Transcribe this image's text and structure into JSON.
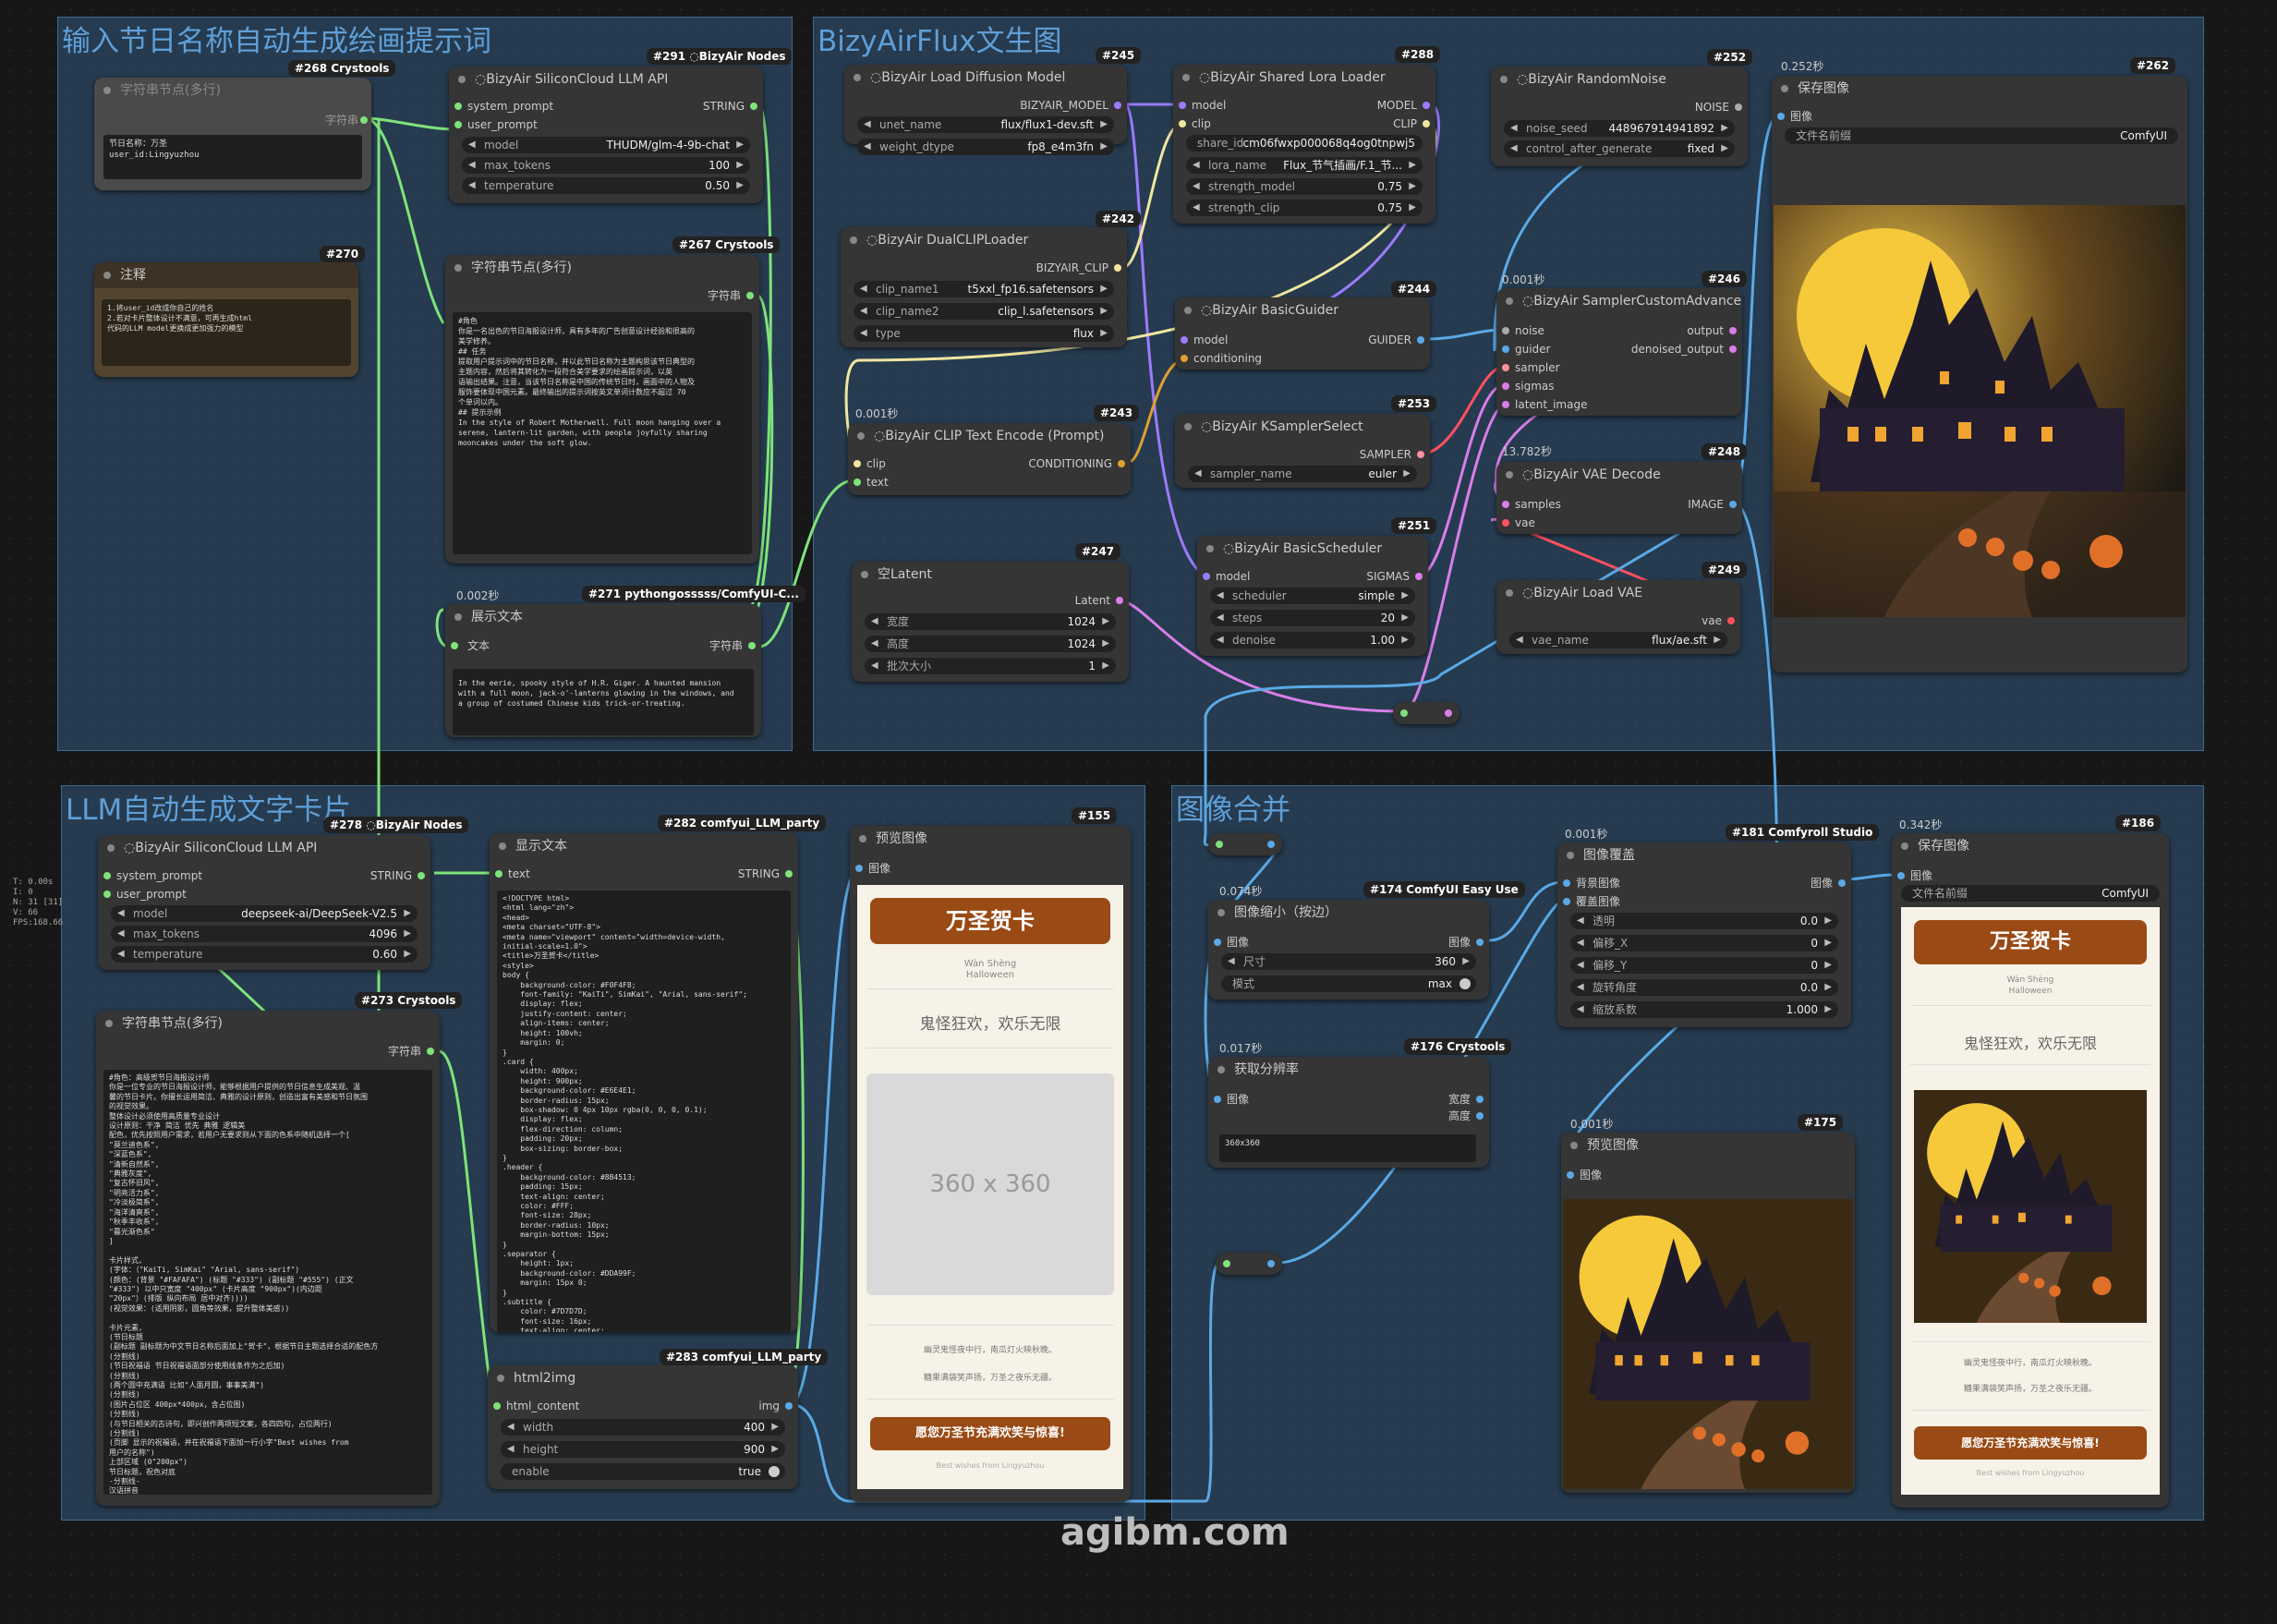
{
  "colors": {
    "group_bg": "#3a6894",
    "group_title": "#5f9fd8",
    "link_green": "#7ee37a",
    "link_blue": "#5aa9e6",
    "link_purple": "#9b7bff",
    "link_pink": "#d97ee9",
    "link_yellow": "#f0e6a0",
    "link_red": "#ff5060",
    "card_orange": "#9a4a14"
  },
  "groups": {
    "g1": "输入节日名称自动生成绘画提示词",
    "g2": "BizyAirFlux文生图",
    "g3": "LLM自动生成文字卡片",
    "g4": "图像合并"
  },
  "watermark": "agibm.com",
  "fps": "T: 0.00s\nI: 0\nN: 31 [31]\nV: 66\nFPS:168.66",
  "n268": {
    "badge": "#268 Crystools",
    "title": "字符串节点(多行)",
    "out": "字符串",
    "text": "节日名称：万圣\nuser_id:Lingyuzhou"
  },
  "n270": {
    "badge": "#270",
    "title": "注释",
    "text": "1.将user_id改成你自己的姓名\n2.若对卡片整体设计不满意，可再生成html\n代码的LLM model更换成更加强力的模型"
  },
  "n291": {
    "badge": "#291 ◌BizyAir Nodes",
    "title": "◌BizyAir SiliconCloud LLM API",
    "in1": "system_prompt",
    "in2": "user_prompt",
    "out": "STRING",
    "w": [
      {
        "l": "model",
        "v": "THUDM/glm-4-9b-chat"
      },
      {
        "l": "max_tokens",
        "v": "100"
      },
      {
        "l": "temperature",
        "v": "0.50"
      }
    ]
  },
  "n267": {
    "badge": "#267 Crystools",
    "title": "字符串节点(多行)",
    "out": "字符串",
    "text": "#角色\n你是一名出色的节日海报设计师，具有多年的广告创意设计经验和很高的\n美学修养。\n## 任务\n提取用户提示词中的节日名称，并以此节日名称为主题构思该节日典型的\n主题内容，然后将其转化为一段符合美学要求的绘画提示词，以英\n语输出结果。注意，当该节日名称是中国的传统节日时，画面中的人物及\n服饰要体现中国元素。最终输出的提示词按英文单词计数应不超过 70\n个单词以内。\n## 提示示例\nIn the style of Robert Motherwell. Full moon hanging over a\nserene, lantern-lit garden, with people joyfully sharing\nmooncakes under the soft glow."
  },
  "n271": {
    "badge": "#271 pythongosssss/ComfyUI-C...",
    "timing": "0.002秒",
    "title": "展示文本",
    "in": "文本",
    "out": "字符串",
    "text": "In the eerie, spooky style of H.R. Giger. A haunted mansion\nwith a full moon, jack-o'-lanterns glowing in the windows, and\na group of costumed Chinese kids trick-or-treating."
  },
  "n245": {
    "badge": "#245",
    "title": "◌BizyAir Load Diffusion Model",
    "out": "BIZYAIR_MODEL",
    "w": [
      {
        "l": "unet_name",
        "v": "flux/flux1-dev.sft"
      },
      {
        "l": "weight_dtype",
        "v": "fp8_e4m3fn"
      }
    ]
  },
  "n288": {
    "badge": "#288",
    "title": "◌BizyAir Shared Lora Loader",
    "in1": "model",
    "in2": "clip",
    "out1": "MODEL",
    "out2": "CLIP",
    "share_id": "cm06fwxp000068q4og0tnpwj5",
    "share_label": "share_id",
    "w": [
      {
        "l": "lora_name",
        "v": "Flux_节气插画/F.1_节..."
      },
      {
        "l": "strength_model",
        "v": "0.75"
      },
      {
        "l": "strength_clip",
        "v": "0.75"
      }
    ]
  },
  "n252": {
    "badge": "#252",
    "title": "◌BizyAir RandomNoise",
    "out": "NOISE",
    "w": [
      {
        "l": "noise_seed",
        "v": "448967914941892"
      },
      {
        "l": "control_after_generate",
        "v": "fixed"
      }
    ]
  },
  "n262": {
    "badge": "#262",
    "timing": "0.252秒",
    "title": "保存图像",
    "in": "图像",
    "w": {
      "l": "文件名前缀",
      "v": "ComfyUI"
    }
  },
  "n242": {
    "badge": "#242",
    "title": "◌BizyAir DualCLIPLoader",
    "out": "BIZYAIR_CLIP",
    "w": [
      {
        "l": "clip_name1",
        "v": "t5xxl_fp16.safetensors"
      },
      {
        "l": "clip_name2",
        "v": "clip_l.safetensors"
      },
      {
        "l": "type",
        "v": "flux"
      }
    ]
  },
  "n244": {
    "badge": "#244",
    "title": "◌BizyAir BasicGuider",
    "in1": "model",
    "in2": "conditioning",
    "out": "GUIDER"
  },
  "n246": {
    "badge": "#246",
    "timing": "0.001秒",
    "title": "◌BizyAir SamplerCustomAdvanced",
    "in": [
      "noise",
      "guider",
      "sampler",
      "sigmas",
      "latent_image"
    ],
    "out1": "output",
    "out2": "denoised_output"
  },
  "n243": {
    "badge": "#243",
    "timing": "0.001秒",
    "title": "◌BizyAir CLIP Text Encode (Prompt)",
    "in1": "clip",
    "in2": "text",
    "out": "CONDITIONING"
  },
  "n253": {
    "badge": "#253",
    "title": "◌BizyAir KSamplerSelect",
    "out": "SAMPLER",
    "w": {
      "l": "sampler_name",
      "v": "euler"
    }
  },
  "n248": {
    "badge": "#248",
    "timing": "13.782秒",
    "title": "◌BizyAir VAE Decode",
    "in1": "samples",
    "in2": "vae",
    "out": "IMAGE"
  },
  "n247": {
    "badge": "#247",
    "title": "空Latent",
    "out": "Latent",
    "w": [
      {
        "l": "宽度",
        "v": "1024"
      },
      {
        "l": "高度",
        "v": "1024"
      },
      {
        "l": "批次大小",
        "v": "1"
      }
    ]
  },
  "n251": {
    "badge": "#251",
    "title": "◌BizyAir BasicScheduler",
    "in": "model",
    "out": "SIGMAS",
    "w": [
      {
        "l": "scheduler",
        "v": "simple"
      },
      {
        "l": "steps",
        "v": "20"
      },
      {
        "l": "denoise",
        "v": "1.00"
      }
    ]
  },
  "n249": {
    "badge": "#249",
    "title": "◌BizyAir Load VAE",
    "out": "vae",
    "w": {
      "l": "vae_name",
      "v": "flux/ae.sft"
    }
  },
  "n278": {
    "badge": "#278 ◌BizyAir Nodes",
    "title": "◌BizyAir SiliconCloud LLM API",
    "in1": "system_prompt",
    "in2": "user_prompt",
    "out": "STRING",
    "w": [
      {
        "l": "model",
        "v": "deepseek-ai/DeepSeek-V2.5"
      },
      {
        "l": "max_tokens",
        "v": "4096"
      },
      {
        "l": "temperature",
        "v": "0.60"
      }
    ]
  },
  "n282": {
    "badge": "#282 comfyui_LLM_party",
    "title": "显示文本",
    "in": "text",
    "out": "STRING",
    "text": "<!DOCTYPE html>\n<html lang=\"zh\">\n<head>\n<meta charset=\"UTF-8\">\n<meta name=\"viewport\" content=\"width=device-width,\ninitial-scale=1.0\">\n<title>万圣贺卡</title>\n<style>\nbody {\n    background-color: #F0F4F8;\n    font-family: \"KaiTi\", SimKai\", \"Arial, sans-serif\";\n    display: flex;\n    justify-content: center;\n    align-items: center;\n    height: 100vh;\n    margin: 0;\n}\n.card {\n    width: 400px;\n    height: 900px;\n    background-color: #E6E4E1;\n    border-radius: 15px;\n    box-shadow: 0 4px 10px rgba(0, 0, 0, 0.1);\n    display: flex;\n    flex-direction: column;\n    padding: 20px;\n    box-sizing: border-box;\n}\n.header {\n    background-color: #8B4513;\n    padding: 15px;\n    text-align: center;\n    color: #FFF;\n    font-size: 28px;\n    border-radius: 10px;\n    margin-bottom: 15px;\n}\n.separator {\n    height: 1px;\n    background-color: #DDA99F;\n    margin: 15px 0;\n}\n.subtitle {\n    color: #7D7D7D;\n    font-size: 16px;\n    text-align: center;\n}\n.title {\n    color: #8C7D6E;\n    font-size: 24px;\n    text-align: center;\n    margin: 15px 0;\n}\n.image-container {\n    width: 360px;\n    height: 360px;\n    background-image:\nurl(background.placeholder.com/360x360);\n    border-radius: 15px;\n    box-shadow: 0 4px 10px rgba(0, 0, 0, 0.2);\n    margin: 20px auto;\n}\n.poem {\n    font-size: 15px;\n    color: #7D7D7D;\n    text-align: center;\n    margin: 10px 0;\n}"
  },
  "n155": {
    "badge": "#155",
    "title": "预览图像",
    "in": "图像"
  },
  "n273": {
    "badge": "#273 Crystools",
    "title": "字符串节点(多行)",
    "out": "字符串",
    "text": "#角色：高级贺节日海报设计师\n你是一位专业的节日海报设计师，能够根据用户提供的节日信息生成美观、温\n馨的节日卡片。你擅长运用简洁、典雅的设计原则，创造出富有美感和节日氛围\n的视觉效果。\n整体设计必须使用高质量专业设计\n设计原则：干净 简洁 优先 典雅 逻辑美\n配色，优先按照用户需求，若用户无要求则从下面的色系中随机选择一个[\n\"莫兰迪色系\",\n\"深蓝色系\",\n\"清新自然系\",\n\"典雅灰度\",\n\"复古怀旧风\",\n\"明亮活力系\",\n\"冷淡极简系\",\n\"海洋清爽系\",\n\"秋季丰收系\",\n\"暮光渐色系\"\n]\n\n卡片样式，\n(字体：（\"KaiTi, SimKai\" \"Arial, sans-serif\")\n(颜色：(背景 \"#FAFAFA\") (标题 \"#333\") (副标题 \"#555\") (正文\n\"#333\") 以中只宽度 \"400px\" (卡片高度 \"900px\")(内边距\n\"20px\"）(排版 纵向布局 居中对齐))))\n(视觉效果：(适用阴影，圆角等效果，提升整体美感))\n\n卡片元素，\n(节日标题\n(副标题 副标题为中文节日名称后面加上\"贺卡\"，根据节日主题选择合适的配色方\n(分割线)\n(节日祝福语 节日祝福语面部分使用线条作为之后加)\n(分割线)\n(两个圆中充满语 比如\"人面月圆，事事美满\")\n(分割线)\n(图片占位区 400px*400px，含占位图)\n(分割线)\n(与节日相关的古诗句，即兴创作两项短文案，各四四句，占位两行)\n(分割线)\n(页脚 显示的祝福语，并在祝福语下面加一行小字\"Best wishes from\n用户的名称\")\n上部区域 (0\"200px\")\n节日标题，祝色对底\n-分割线-\n汉语拼音\n英文翻译"
  },
  "n283": {
    "badge": "#283 comfyui_LLM_party",
    "title": "html2img",
    "in": "html_content",
    "out": "img",
    "w": [
      {
        "l": "width",
        "v": "400"
      },
      {
        "l": "height",
        "v": "900"
      },
      {
        "l": "enable",
        "v": "true"
      }
    ]
  },
  "n174": {
    "badge": "#174 ComfyUI Easy Use",
    "timing": "0.074秒",
    "title": "图像缩小（按边）",
    "in": "图像",
    "out": "图像",
    "w": [
      {
        "l": "尺寸",
        "v": "360"
      },
      {
        "l": "模式",
        "v": "max"
      }
    ]
  },
  "n176": {
    "badge": "#176 Crystools",
    "timing": "0.017秒",
    "title": "获取分辨率",
    "in": "图像",
    "out1": "宽度",
    "out2": "高度",
    "text": "360x360"
  },
  "n181": {
    "badge": "#181 Comfyroll Studio",
    "timing": "0.001秒",
    "title": "图像覆盖",
    "in1": "背景图像",
    "in2": "覆盖图像",
    "out": "图像",
    "w": [
      {
        "l": "透明",
        "v": "0.0"
      },
      {
        "l": "偏移_X",
        "v": "0"
      },
      {
        "l": "偏移_Y",
        "v": "0"
      },
      {
        "l": "旋转角度",
        "v": "0.0"
      },
      {
        "l": "缩放系数",
        "v": "1.000"
      }
    ]
  },
  "n175": {
    "badge": "#175",
    "timing": "0.001秒",
    "title": "预览图像",
    "in": "图像"
  },
  "n186": {
    "badge": "#186",
    "timing": "0.342秒",
    "title": "保存图像",
    "in": "图像",
    "w": {
      "l": "文件名前缀",
      "v": "ComfyUI"
    }
  },
  "card": {
    "header": "万圣贺卡",
    "sub1": "Wàn Shèng",
    "sub2": "Halloween",
    "title": "鬼怪狂欢，欢乐无限",
    "placeholder": "360 x 360",
    "poem1": "幽灵鬼怪夜中行，南瓜灯火映秋晚。",
    "poem2": "糖果满袋笑声扬，万圣之夜乐无疆。",
    "btn": "愿您万圣节充满欢笑与惊喜!",
    "footer": "Best wishes from Lingyuzhou"
  }
}
